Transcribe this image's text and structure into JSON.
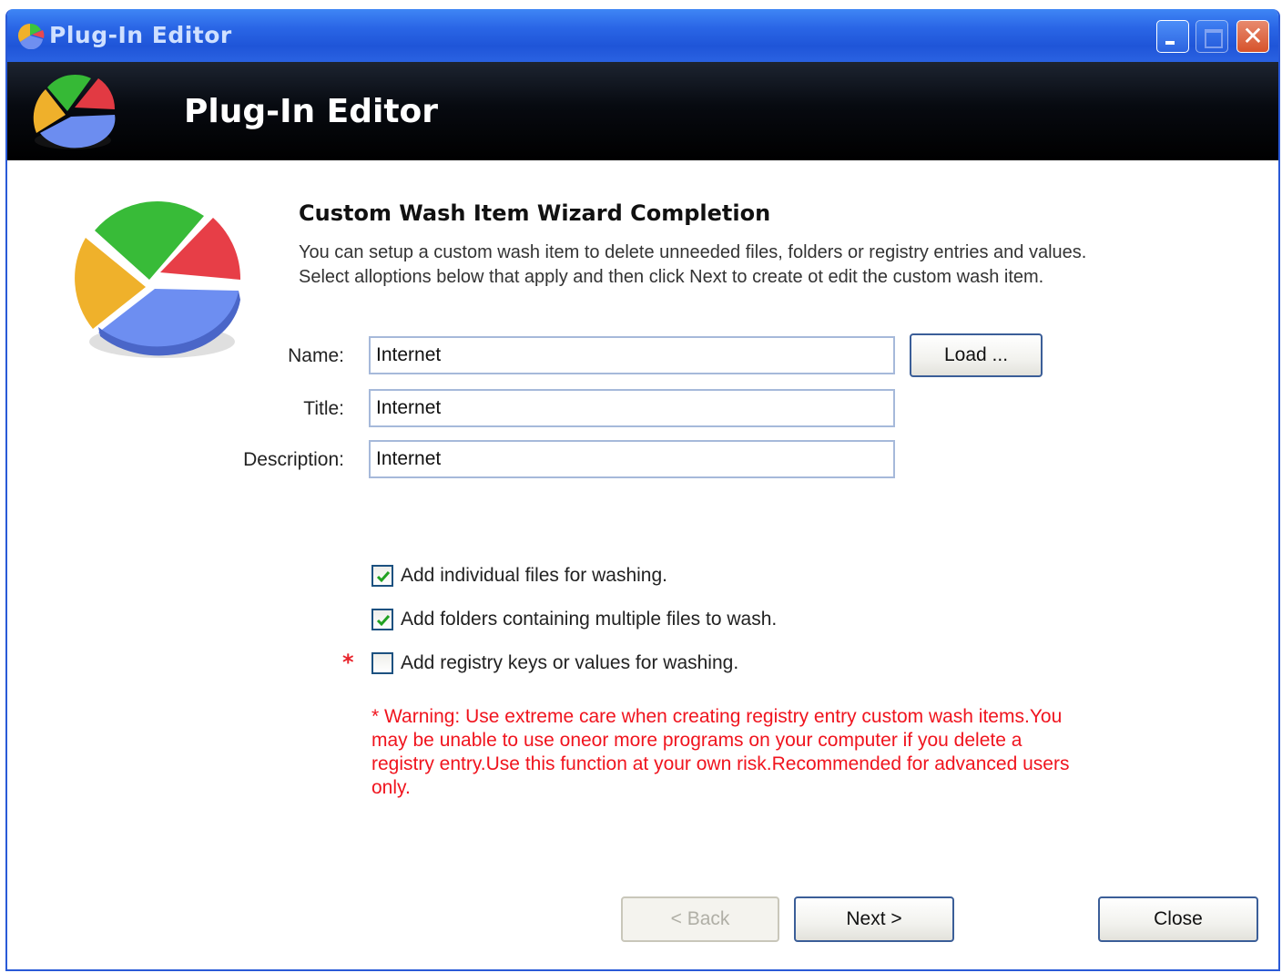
{
  "window": {
    "title": "Plug-In Editor",
    "banner_title": "Plug-In Editor",
    "minimize_label": "",
    "maximize_label": "",
    "close_label": "✕"
  },
  "wizard": {
    "heading": "Custom Wash Item Wizard Completion",
    "intro_line1": "You can setup a custom wash item to delete unneeded files, folders or registry entries and values.",
    "intro_line2": "Select alloptions below that apply and then click Next to create ot edit the custom wash item."
  },
  "form": {
    "name_label": "Name:",
    "name_value": "Internet",
    "title_label": "Title:",
    "title_value": "Internet",
    "description_label": "Description:",
    "description_value": "Internet",
    "load_button": "Load ..."
  },
  "options": [
    {
      "label": "Add individual files for washing.",
      "checked": true
    },
    {
      "label": "Add folders containing multiple files to wash.",
      "checked": true
    },
    {
      "label": "Add registry keys or values for washing.",
      "checked": false
    }
  ],
  "required_marker": "*",
  "warning": "* Warning: Use extreme care when creating registry entry custom wash items.You may be unable to use oneor more programs on your computer if you delete a registry entry.Use this function at your own risk.Recommended for advanced users only.",
  "buttons": {
    "back": "< Back",
    "next": "Next >",
    "close": "Close"
  },
  "colors": {
    "titlebar": "#2a66e6",
    "banner": "#000000",
    "warning": "#f0141e",
    "check": "#21a121"
  },
  "icons": {
    "app": "pie-chart-icon",
    "check": "checkmark-icon"
  }
}
